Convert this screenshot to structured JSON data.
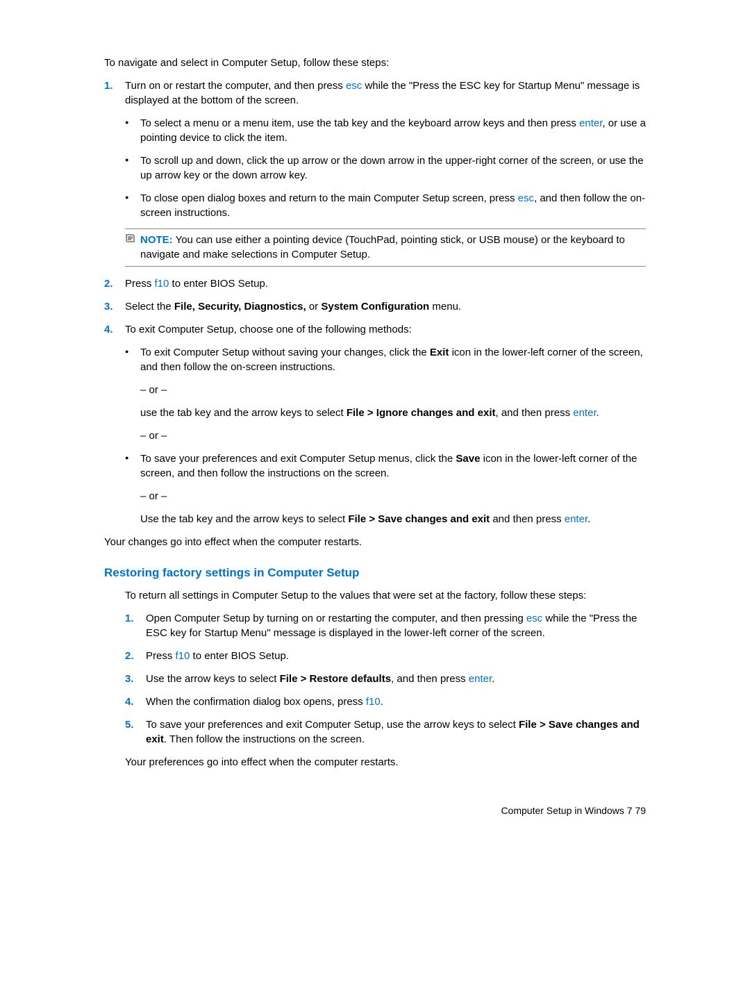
{
  "intro": "To navigate and select in Computer Setup, follow these steps:",
  "step1": {
    "num": "1.",
    "text1": "Turn on or restart the computer, and then press ",
    "key1": "esc",
    "text2": " while the \"Press the ESC key for Startup Menu\" message is displayed at the bottom of the screen.",
    "b1a": "To select a menu or a menu item, use the tab key and the keyboard arrow keys and then press ",
    "b1key": "enter",
    "b1b": ", or use a pointing device to click the item.",
    "b2": "To scroll up and down, click the up arrow or the down arrow in the upper-right corner of the screen, or use the up arrow key or the down arrow key.",
    "b3a": "To close open dialog boxes and return to the main Computer Setup screen, press ",
    "b3key": "esc",
    "b3b": ", and then follow the on-screen instructions."
  },
  "note1": {
    "label": "NOTE:",
    "text": "   You can use either a pointing device (TouchPad, pointing stick, or USB mouse) or the keyboard to navigate and make selections in Computer Setup."
  },
  "step2": {
    "num": "2.",
    "a": "Press ",
    "key": "f10",
    "b": " to enter BIOS Setup."
  },
  "step3": {
    "num": "3.",
    "a": "Select the ",
    "bold1": "File, Security, Diagnostics,",
    "mid": " or ",
    "bold2": "System Configuration",
    "b": " menu."
  },
  "step4": {
    "num": "4.",
    "text": "To exit Computer Setup, choose one of the following methods:",
    "b1a": "To exit Computer Setup without saving your changes, click the ",
    "b1bold": "Exit",
    "b1b": " icon in the lower-left corner of the screen, and then follow the on-screen instructions.",
    "or": "– or –",
    "s1a": "use the tab key and the arrow keys to select ",
    "s1bold": "File > Ignore changes and exit",
    "s1b": ", and then press ",
    "s1key": "enter",
    "s1c": ".",
    "b2a": "To save your preferences and exit Computer Setup menus, click the ",
    "b2bold": "Save",
    "b2b": " icon in the lower-left corner of the screen, and then follow the instructions on the screen.",
    "s2a": "Use the tab key and the arrow keys to select ",
    "s2bold": "File > Save changes and exit",
    "s2b": " and then press ",
    "s2key": "enter",
    "s2c": "."
  },
  "closing1": "Your changes go into effect when the computer restarts.",
  "sectionTitle": "Restoring factory settings in Computer Setup",
  "sectionIntro": "To return all settings in Computer Setup to the values that were set at the factory, follow these steps:",
  "r1": {
    "num": "1.",
    "a": "Open Computer Setup by turning on or restarting the computer, and then pressing ",
    "key": "esc",
    "b": " while the \"Press the ESC key for Startup Menu\" message is displayed in the lower-left corner of the screen."
  },
  "r2": {
    "num": "2.",
    "a": "Press ",
    "key": "f10",
    "b": " to enter BIOS Setup."
  },
  "r3": {
    "num": "3.",
    "a": "Use the arrow keys to select ",
    "bold": "File > Restore defaults",
    "b": ", and then press ",
    "key": "enter",
    "c": "."
  },
  "r4": {
    "num": "4.",
    "a": "When the confirmation dialog box opens, press ",
    "key": "f10",
    "b": "."
  },
  "r5": {
    "num": "5.",
    "a": "To save your preferences and exit Computer Setup, use the arrow keys to select ",
    "bold": "File > Save changes and exit",
    "b": ". Then follow the instructions on the screen."
  },
  "closing2": "Your preferences go into effect when the computer restarts.",
  "footer": "Computer Setup in Windows 7   79"
}
